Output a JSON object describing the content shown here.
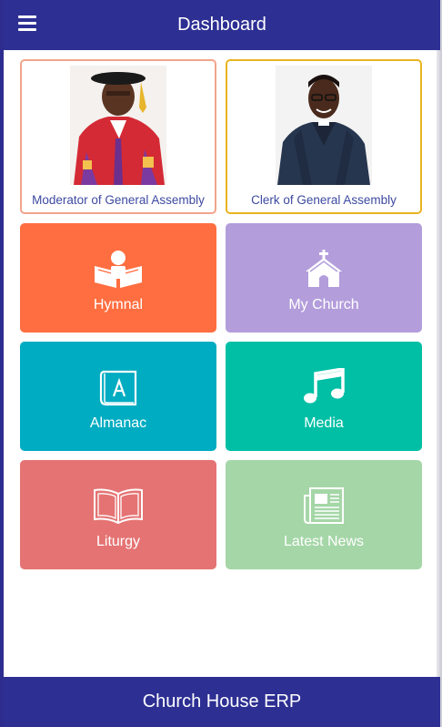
{
  "appbar": {
    "title": "Dashboard",
    "menu_icon": "hamburger-menu-icon"
  },
  "leaders": [
    {
      "caption": "Moderator of General Assembly",
      "border_color": "#f2a48b",
      "photo": "moderator-portrait"
    },
    {
      "caption": "Clerk of General Assembly",
      "border_color": "#e9b420",
      "photo": "clerk-portrait"
    }
  ],
  "tiles": [
    {
      "label": "Hymnal",
      "color": "#ff6e40",
      "icon": "reading-person-icon"
    },
    {
      "label": "My Church",
      "color": "#b39ddb",
      "icon": "church-icon"
    },
    {
      "label": "Almanac",
      "color": "#00acc1",
      "icon": "almanac-book-icon"
    },
    {
      "label": "Media",
      "color": "#00bfa5",
      "icon": "music-note-icon"
    },
    {
      "label": "Liturgy",
      "color": "#e57373",
      "icon": "open-book-icon"
    },
    {
      "label": "Latest News",
      "color": "#a5d6a7",
      "icon": "newspaper-icon"
    }
  ],
  "footer": {
    "title": "Church House ERP"
  }
}
